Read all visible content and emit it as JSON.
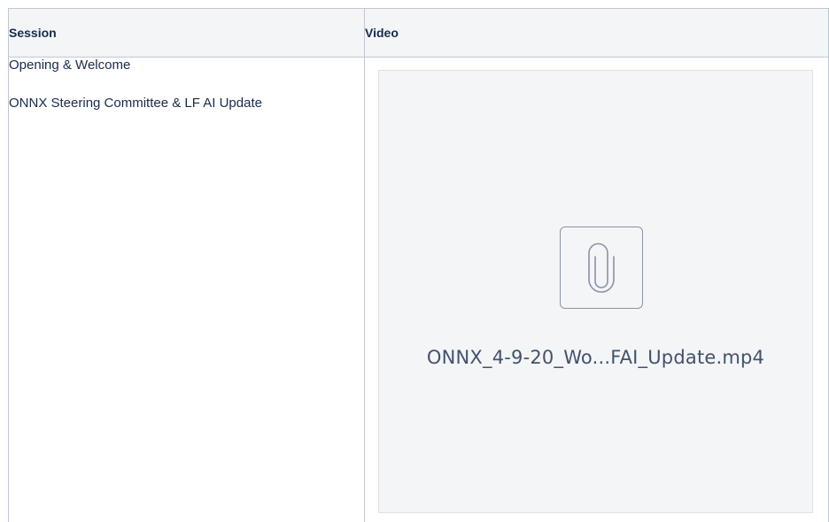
{
  "table": {
    "headers": {
      "session": "Session",
      "video": "Video"
    },
    "sessions": [
      "Opening & Welcome",
      "ONNX Steering Committee & LF AI Update"
    ],
    "video": {
      "icon": "paperclip-icon",
      "file_name": "ONNX_4-9-20_Wo...FAI_Update.mp4"
    }
  },
  "colors": {
    "header_bg": "#f4f5f7",
    "border": "#c1c7d0",
    "preview_bg": "#f4f5f7",
    "text": "#172b4d",
    "icon": "#8993a4"
  }
}
